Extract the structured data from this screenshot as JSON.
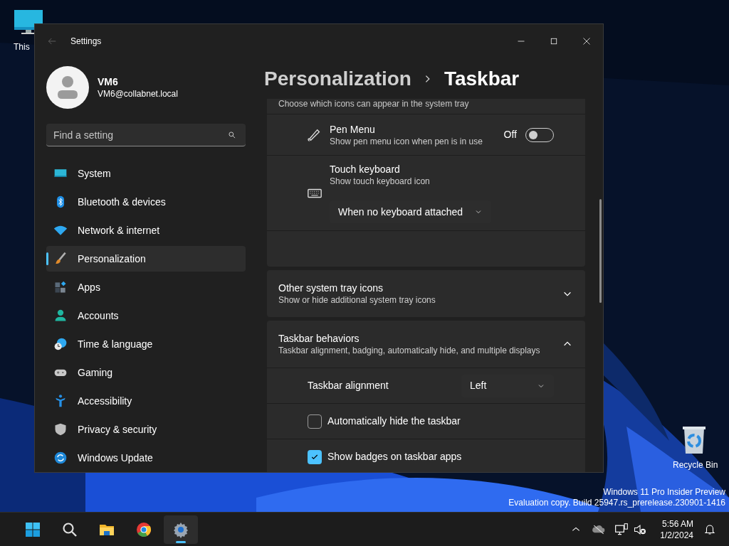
{
  "desktop": {
    "icons": [
      {
        "label": "This"
      },
      {
        "label": "Recycle Bin"
      }
    ],
    "build_info": [
      "Windows 11 Pro Insider Preview",
      "Evaluation copy. Build 25947.rs_prerelease.230901-1416"
    ]
  },
  "window": {
    "title": "Settings"
  },
  "user": {
    "name": "VM6",
    "email": "VM6@collabnet.local"
  },
  "search": {
    "placeholder": "Find a setting"
  },
  "nav": [
    {
      "label": "System",
      "selected": false
    },
    {
      "label": "Bluetooth & devices",
      "selected": false
    },
    {
      "label": "Network & internet",
      "selected": false
    },
    {
      "label": "Personalization",
      "selected": true
    },
    {
      "label": "Apps",
      "selected": false
    },
    {
      "label": "Accounts",
      "selected": false
    },
    {
      "label": "Time & language",
      "selected": false
    },
    {
      "label": "Gaming",
      "selected": false
    },
    {
      "label": "Accessibility",
      "selected": false
    },
    {
      "label": "Privacy & security",
      "selected": false
    },
    {
      "label": "Windows Update",
      "selected": false
    }
  ],
  "breadcrumb": [
    "Personalization",
    "Taskbar"
  ],
  "system_tray_icons": {
    "description": "Choose which icons can appear in the system tray",
    "rows": [
      {
        "kind": "toggle",
        "title": "Pen Menu",
        "subtitle": "Show pen menu icon when pen is in use",
        "state_label": "Off",
        "on": false
      },
      {
        "kind": "dropdown",
        "title": "Touch keyboard",
        "subtitle": "Show touch keyboard icon",
        "value": "When no keyboard attached"
      }
    ]
  },
  "sections": [
    {
      "title": "Other system tray icons",
      "subtitle": "Show or hide additional system tray icons",
      "expanded": false
    },
    {
      "title": "Taskbar behaviors",
      "subtitle": "Taskbar alignment, badging, automatically hide, and multiple displays",
      "expanded": true,
      "rows": [
        {
          "kind": "dropdown",
          "title": "Taskbar alignment",
          "value": "Left"
        },
        {
          "kind": "checkbox",
          "title": "Automatically hide the taskbar",
          "checked": false
        },
        {
          "kind": "checkbox",
          "title": "Show badges on taskbar apps",
          "checked": true
        }
      ]
    }
  ],
  "taskbar": {
    "apps": [
      {
        "selected": false
      },
      {
        "selected": false
      },
      {
        "selected": false
      },
      {
        "selected": false
      },
      {
        "selected": true
      }
    ],
    "time": "5:56 AM",
    "date": "1/2/2024"
  }
}
